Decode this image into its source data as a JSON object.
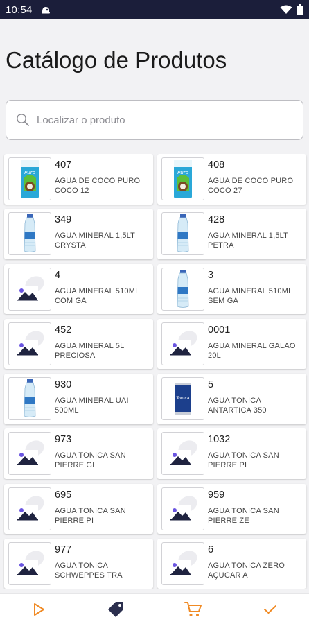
{
  "status": {
    "time": "10:54"
  },
  "page": {
    "title": "Catálogo de Produtos"
  },
  "search": {
    "placeholder": "Localizar o produto",
    "value": ""
  },
  "products": [
    {
      "code": "407",
      "name": "AGUA DE COCO PURO COCO 12",
      "image": "coconut-water-box"
    },
    {
      "code": "408",
      "name": "AGUA DE COCO PURO COCO 27",
      "image": "coconut-water-box"
    },
    {
      "code": "349",
      "name": "AGUA MINERAL 1,5LT CRYSTA",
      "image": "water-bottle"
    },
    {
      "code": "428",
      "name": "AGUA MINERAL 1,5LT PETRA",
      "image": "water-bottle"
    },
    {
      "code": "4",
      "name": "AGUA MINERAL 510ML COM GA",
      "image": "placeholder"
    },
    {
      "code": "3",
      "name": "AGUA MINERAL 510ML SEM GA",
      "image": "water-bottle"
    },
    {
      "code": "452",
      "name": "AGUA MINERAL 5L PRECIOSA",
      "image": "placeholder"
    },
    {
      "code": "0001",
      "name": "AGUA MINERAL GALAO 20L",
      "image": "placeholder"
    },
    {
      "code": "930",
      "name": "AGUA MINERAL UAI 500ML",
      "image": "water-bottle"
    },
    {
      "code": "5",
      "name": "AGUA TONICA ANTARTICA 350",
      "image": "soda-can"
    },
    {
      "code": "973",
      "name": "AGUA TONICA SAN PIERRE GI",
      "image": "placeholder"
    },
    {
      "code": "1032",
      "name": "AGUA TONICA SAN PIERRE PI",
      "image": "placeholder"
    },
    {
      "code": "695",
      "name": "AGUA TONICA SAN PIERRE PI",
      "image": "placeholder"
    },
    {
      "code": "959",
      "name": "AGUA TONICA SAN PIERRE ZE",
      "image": "placeholder"
    },
    {
      "code": "977",
      "name": "AGUA TONICA SCHWEPPES TRA",
      "image": "placeholder"
    },
    {
      "code": "6",
      "name": "AGUA TONICA ZERO AÇUCAR A",
      "image": "placeholder"
    }
  ],
  "nav": {
    "items": [
      {
        "icon": "play-icon"
      },
      {
        "icon": "tag-icon",
        "active": true
      },
      {
        "icon": "cart-icon"
      },
      {
        "icon": "check-icon"
      }
    ]
  },
  "colors": {
    "statusBar": "#1b1e3a",
    "accent": "#f08a24",
    "navActive": "#2b2f4e"
  }
}
